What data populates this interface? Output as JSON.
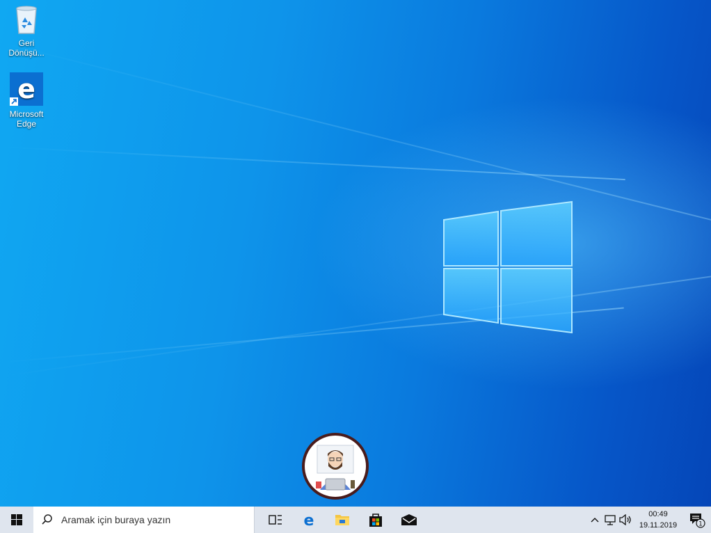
{
  "desktop": {
    "icons": [
      {
        "name": "recycle-bin",
        "label_line1": "Geri",
        "label_line2": "Dönüşü..."
      },
      {
        "name": "microsoft-edge",
        "label_line1": "Microsoft",
        "label_line2": "Edge"
      }
    ]
  },
  "taskbar": {
    "search_placeholder": "Aramak için buraya yazın",
    "pinned": [
      "task-view-icon",
      "edge-icon",
      "file-explorer-icon",
      "store-icon",
      "mail-icon"
    ],
    "tray_icons": [
      "chevron-up-icon",
      "network-icon",
      "volume-icon"
    ],
    "clock": {
      "time": "00:49",
      "date": "19.11.2019"
    },
    "notification_count": "1"
  },
  "colors": {
    "accent": "#0a78e6",
    "taskbar": "#dfe5ee"
  }
}
